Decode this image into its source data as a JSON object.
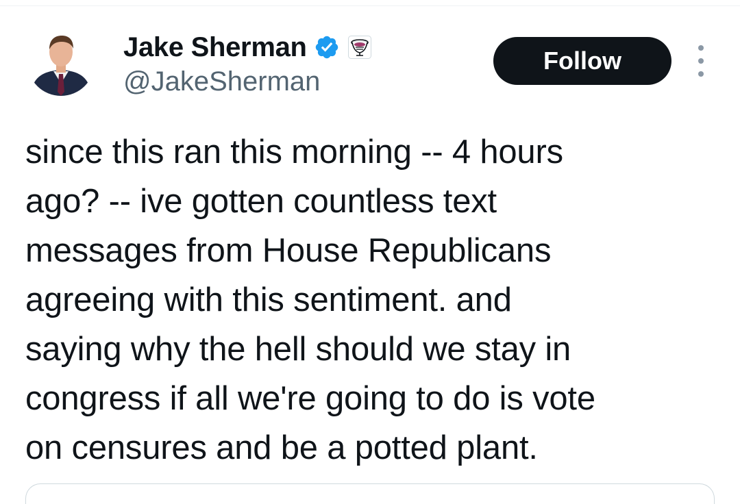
{
  "author": {
    "display_name": "Jake Sherman",
    "handle": "@JakeSherman"
  },
  "icons": {
    "verified": "verified-badge-icon",
    "affiliate": "affiliate-badge-icon",
    "more": "more-options-icon"
  },
  "follow_button": {
    "label": "Follow"
  },
  "tweet": {
    "lines": [
      "since this ran this morning -- 4 hours",
      "ago? -- ive gotten countless text",
      "messages from House Republicans",
      "agreeing with this sentiment. and",
      "saying why the hell should we stay in",
      "congress if all we're going to do is vote",
      "on censures and be a potted plant."
    ]
  },
  "colors": {
    "text": "#0f1419",
    "secondary": "#536471",
    "verified_blue": "#1d9bf0",
    "button_bg": "#0f1419",
    "button_text": "#ffffff",
    "divider": "#eff3f4"
  }
}
